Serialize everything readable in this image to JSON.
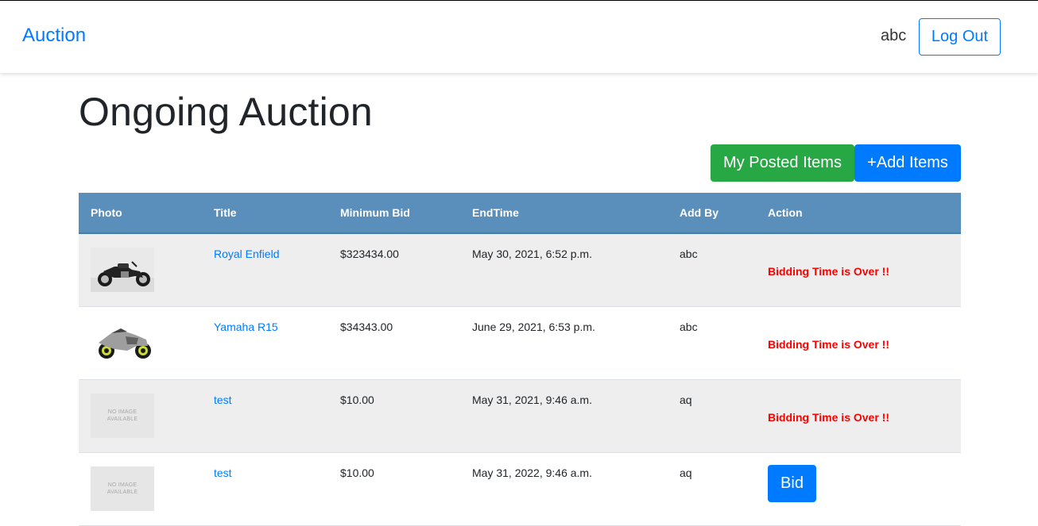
{
  "navbar": {
    "brand": "Auction",
    "username": "abc",
    "logout_label": "Log Out"
  },
  "page": {
    "title": "Ongoing Auction",
    "posted_items_label": "My Posted Items",
    "add_items_label": "+Add Items"
  },
  "table": {
    "headers": {
      "photo": "Photo",
      "title": "Title",
      "min_bid": "Minimum Bid",
      "end_time": "EndTime",
      "add_by": "Add By",
      "action": "Action"
    },
    "no_image_line1": "NO IMAGE",
    "no_image_line2": "AVAILABLE",
    "rows": [
      {
        "photo": "royal-enfield-photo",
        "title": "Royal Enfield",
        "min_bid": "$323434.00",
        "end_time": "May 30, 2021, 6:52 p.m.",
        "add_by": "abc",
        "action": "Bidding Time is Over !!"
      },
      {
        "photo": "yamaha-r15-photo",
        "title": "Yamaha R15",
        "min_bid": "$34343.00",
        "end_time": "June 29, 2021, 6:53 p.m.",
        "add_by": "abc",
        "action": "Bidding Time is Over !!"
      },
      {
        "photo": "no-image",
        "title": "test",
        "min_bid": "$10.00",
        "end_time": "May 31, 2021, 9:46 a.m.",
        "add_by": "aq",
        "action": "Bidding Time is Over !!"
      },
      {
        "photo": "no-image",
        "title": "test",
        "min_bid": "$10.00",
        "end_time": "May 31, 2022, 9:46 a.m.",
        "add_by": "aq",
        "action": "Bid"
      }
    ]
  },
  "colors": {
    "primary": "#007bff",
    "success": "#28a745",
    "table_header": "#5a8fbb",
    "danger_text": "#ff0000"
  }
}
